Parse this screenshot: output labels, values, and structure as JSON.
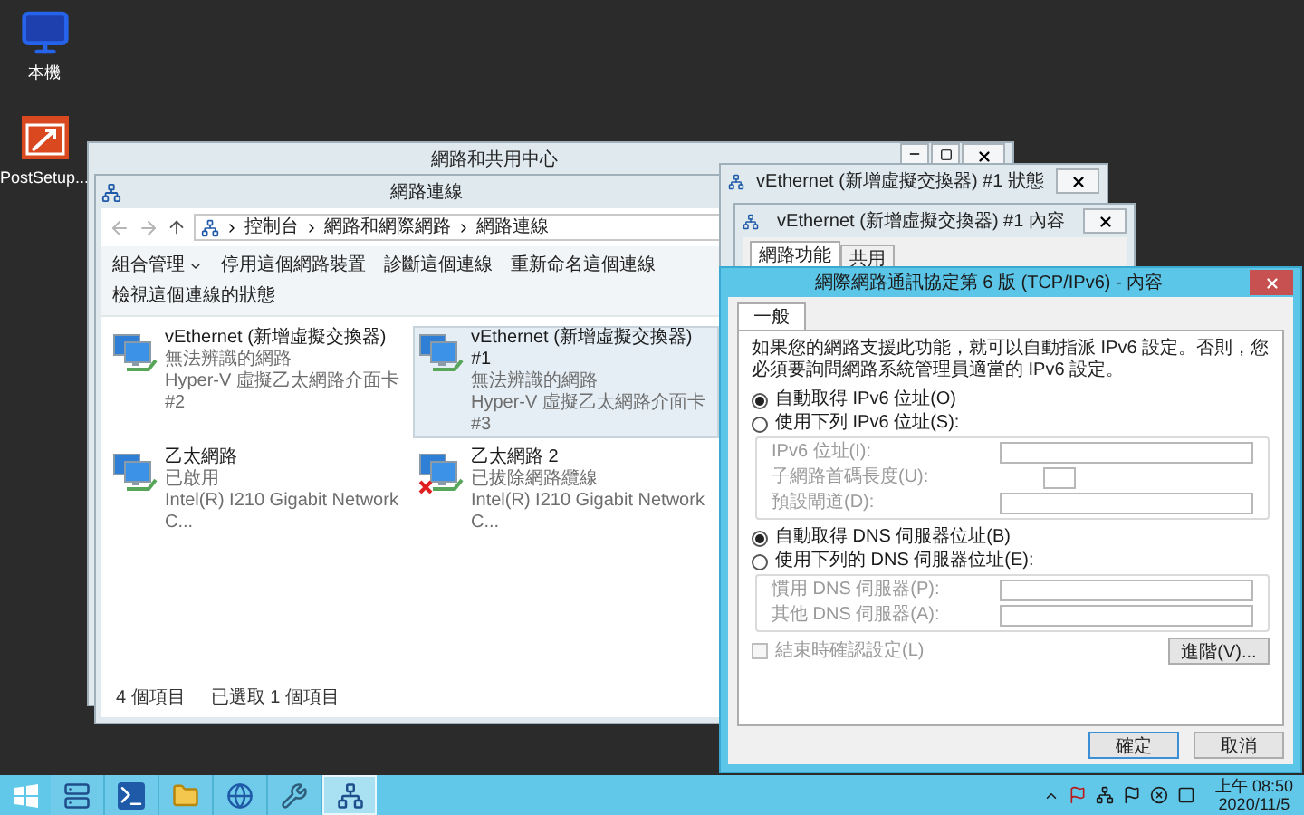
{
  "desktop_icons": [
    {
      "kind": "computer",
      "label": "本機"
    },
    {
      "kind": "setup",
      "label": "PostSetup..."
    }
  ],
  "sharing_center": {
    "title": "網路和共用中心"
  },
  "connections_window": {
    "title": "網路連線",
    "breadcrumb": [
      "控制台",
      "網路和網際網路",
      "網路連線"
    ],
    "toolbar": [
      {
        "label": "組合管理",
        "dropdown": true
      },
      {
        "label": "停用這個網路裝置",
        "dropdown": false
      },
      {
        "label": "診斷這個連線",
        "dropdown": false
      },
      {
        "label": "重新命名這個連線",
        "dropdown": false
      },
      {
        "label": "檢視這個連線的狀態",
        "dropdown": false
      }
    ],
    "connections": [
      {
        "name": "vEthernet (新增虛擬交換器)",
        "status": "無法辨識的網路",
        "device": "Hyper-V 虛擬乙太網路介面卡 #2",
        "selected": false,
        "disconnected": false
      },
      {
        "name": "vEthernet (新增虛擬交換器) #1",
        "status": "無法辨識的網路",
        "device": "Hyper-V 虛擬乙太網路介面卡 #3",
        "selected": true,
        "disconnected": false
      },
      {
        "name": "乙太網路",
        "status": "已啟用",
        "device": "Intel(R) I210 Gigabit Network C...",
        "selected": false,
        "disconnected": false
      },
      {
        "name": "乙太網路 2",
        "status": "已拔除網路纜線",
        "device": "Intel(R) I210 Gigabit Network C...",
        "selected": false,
        "disconnected": true
      }
    ],
    "status_bar": [
      "4 個項目",
      "已選取 1 個項目"
    ]
  },
  "status_dialog": {
    "title": "vEthernet (新增虛擬交換器) #1 狀態"
  },
  "properties_dialog": {
    "title": "vEthernet (新增虛擬交換器) #1 內容",
    "tabs": [
      {
        "label": "網路功能",
        "selected": true
      },
      {
        "label": "共用",
        "selected": false
      }
    ]
  },
  "ipv6_dialog": {
    "title": "網際網路通訊協定第 6 版 (TCP/IPv6) - 內容",
    "tabs": [
      {
        "label": "一般",
        "selected": true
      }
    ],
    "description": "如果您的網路支援此功能，就可以自動指派 IPv6 設定。否則，您必須要詢問網路系統管理員適當的 IPv6 設定。",
    "address_options": [
      {
        "label": "自動取得 IPv6 位址(O)",
        "selected": true
      },
      {
        "label": "使用下列 IPv6 位址(S):",
        "selected": false
      }
    ],
    "address_fields": {
      "disabled": true,
      "fields": [
        {
          "label": "IPv6 位址(I):",
          "kind": "address"
        },
        {
          "label": "子網路首碼長度(U):",
          "kind": "prefix"
        },
        {
          "label": "預設閘道(D):",
          "kind": "address"
        }
      ]
    },
    "dns_options": [
      {
        "label": "自動取得 DNS 伺服器位址(B)",
        "selected": true
      },
      {
        "label": "使用下列的 DNS 伺服器位址(E):",
        "selected": false
      }
    ],
    "dns_fields": {
      "disabled": true,
      "fields": [
        {
          "label": "慣用 DNS 伺服器(P):",
          "kind": "address"
        },
        {
          "label": "其他 DNS 伺服器(A):",
          "kind": "address"
        }
      ]
    },
    "validate": {
      "label": "結束時確認設定(L)",
      "checked": false,
      "disabled": true
    },
    "advanced_button": "進階(V)...",
    "buttons": [
      "確定",
      "取消"
    ]
  },
  "taskbar": {
    "apps": [
      {
        "kind": "server",
        "selected": false
      },
      {
        "kind": "powershell",
        "selected": false
      },
      {
        "kind": "folder",
        "selected": false
      },
      {
        "kind": "browser",
        "selected": false
      },
      {
        "kind": "tools",
        "selected": false
      },
      {
        "kind": "network",
        "selected": true
      }
    ],
    "time": "上午 08:50",
    "date": "2020/11/5"
  }
}
